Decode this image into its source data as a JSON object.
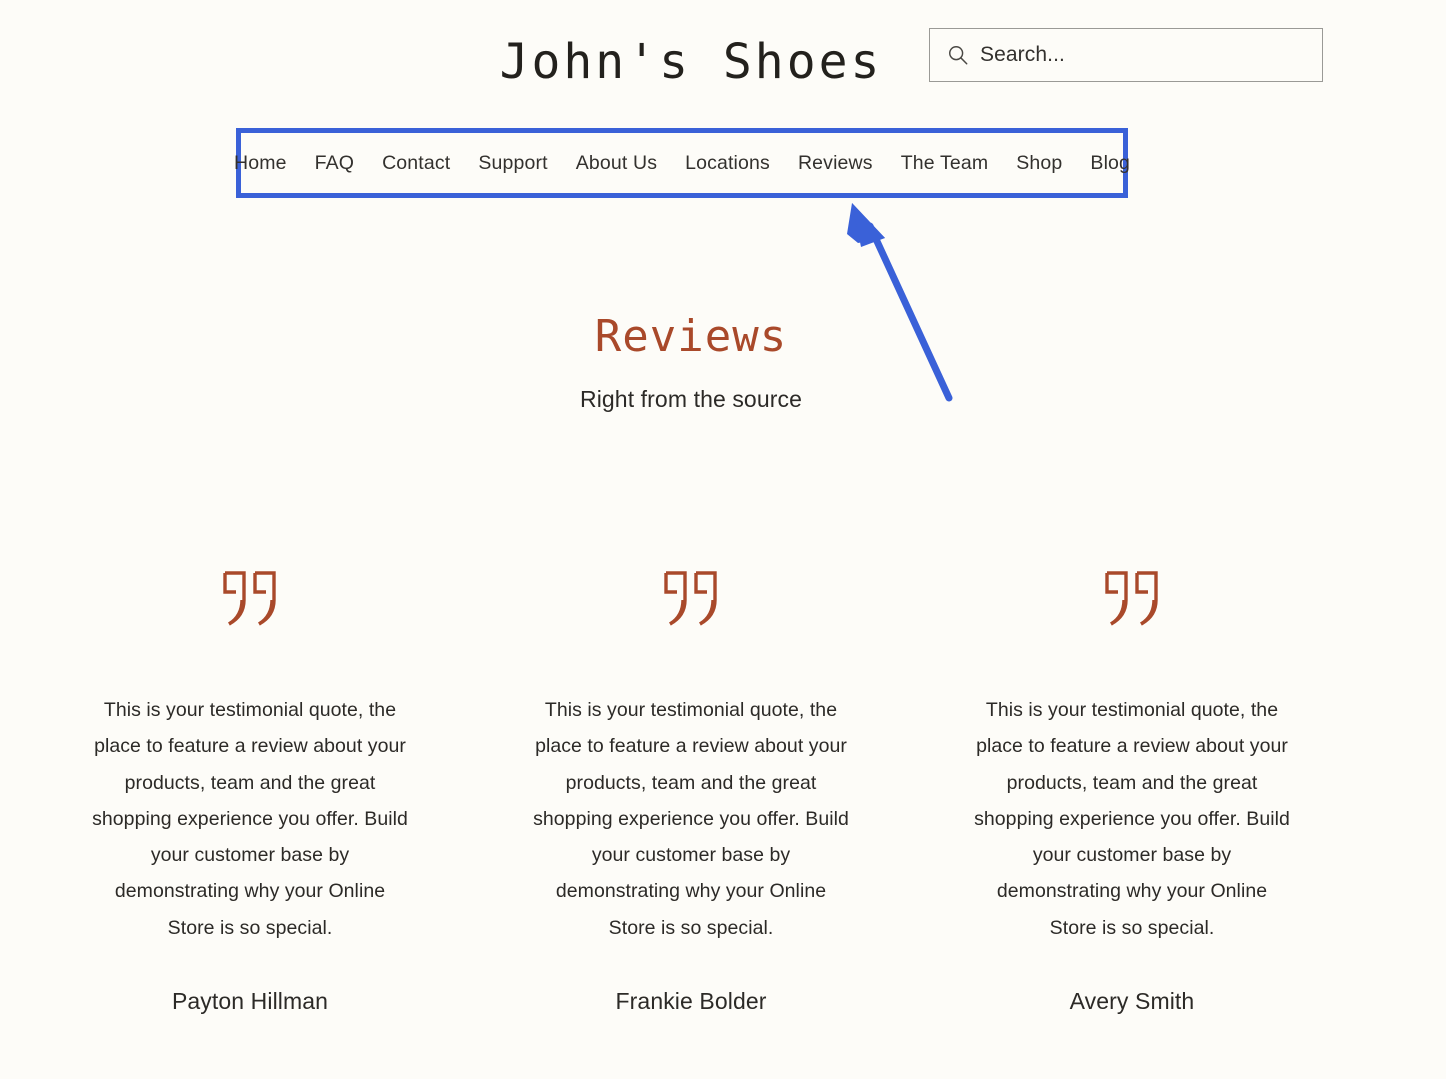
{
  "site": {
    "title": "John's Shoes",
    "background_color": "#fdfcf8",
    "accent_color": "#a9492a",
    "annotation_color": "#3a61d8"
  },
  "search": {
    "icon": "search-icon",
    "placeholder": "Search...",
    "value": ""
  },
  "nav": {
    "highlighted": true,
    "items": [
      {
        "label": "Home"
      },
      {
        "label": "FAQ"
      },
      {
        "label": "Contact"
      },
      {
        "label": "Support"
      },
      {
        "label": "About Us"
      },
      {
        "label": "Locations"
      },
      {
        "label": "Reviews"
      },
      {
        "label": "The Team"
      },
      {
        "label": "Shop"
      },
      {
        "label": "Blog"
      }
    ]
  },
  "annotation": {
    "type": "arrow",
    "points_to": "Reviews",
    "color": "#3a61d8"
  },
  "main": {
    "heading": "Reviews",
    "subheading": "Right from the source",
    "testimonials": [
      {
        "icon": "quote-icon",
        "text": "This is your testimonial quote, the place to feature a review about your products, team and the great shopping experience you offer. Build your customer base by demonstrating why your Online Store is so special.",
        "author": "Payton Hillman"
      },
      {
        "icon": "quote-icon",
        "text": "This is your testimonial quote, the place to feature a review about your products, team and the great shopping experience you offer. Build your customer base by demonstrating why your Online Store is so special.",
        "author": "Frankie Bolder"
      },
      {
        "icon": "quote-icon",
        "text": "This is your testimonial quote, the place to feature a review about your products, team and the great shopping experience you offer. Build your customer base by demonstrating why your Online Store is so special.",
        "author": "Avery Smith"
      }
    ]
  }
}
